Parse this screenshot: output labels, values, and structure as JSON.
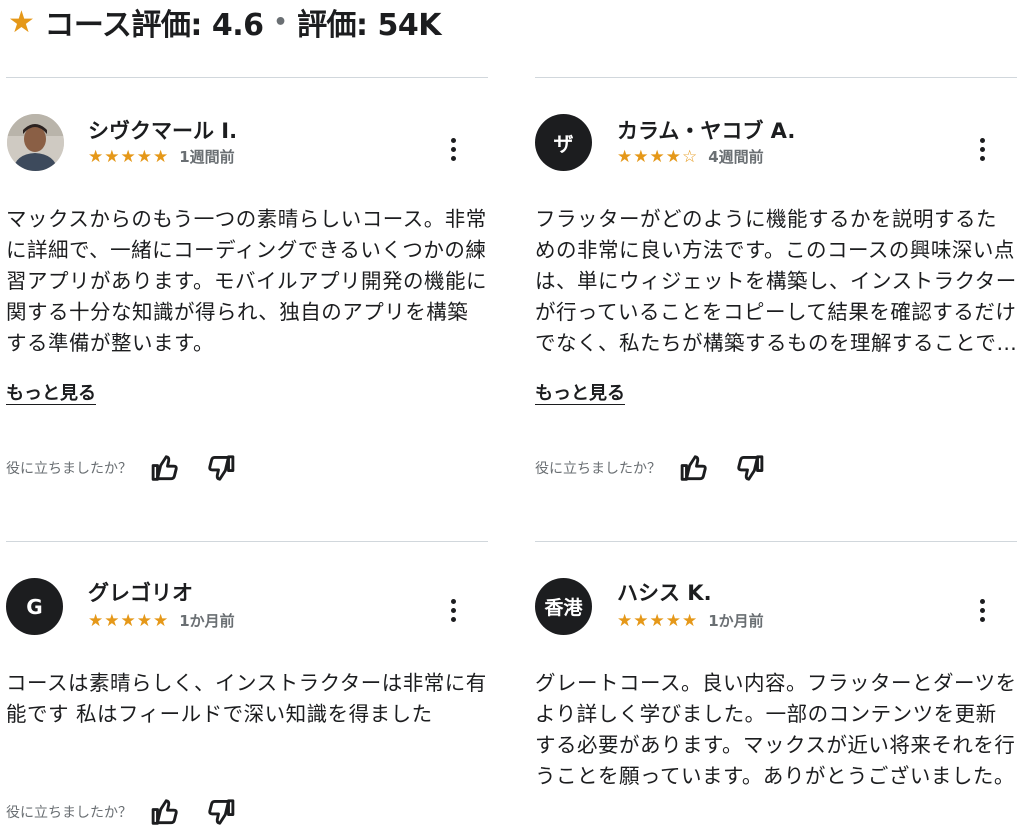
{
  "header": {
    "star_icon": "star-icon",
    "course_rating_label": "コース評価: 4.6",
    "separator": "•",
    "ratings_count_label": "評価: 54K",
    "accent_color": "#e59819"
  },
  "reviews": [
    {
      "avatar_text": "",
      "avatar_kind": "photo",
      "name": "シヴクマール I.",
      "stars": "★★★★★",
      "rating": 5,
      "date": "1週間前",
      "body": "マックスからのもう一つの素晴らしいコース。非常に詳細で、一緒にコーディングできるいくつかの練習アプリがあります。モバイルアプリ開発の機能に関する十分な知識が得られ、独自のアプリを構築する準備が整います。",
      "more_label": "もっと見る",
      "helpful_label": "役に立ちましたか？"
    },
    {
      "avatar_text": "ザ",
      "avatar_kind": "initial",
      "name": "カラム・ヤコブ A.",
      "stars": "★★★★☆",
      "rating": 4,
      "date": "4週間前",
      "body": "フラッターがどのように機能するかを説明するための非常に良い方法です。このコースの興味深い点は、単にウィジェットを構築し、インストラクターが行っていることをコピーして結果を確認するだけでなく、私たちが構築するものを理解することです。",
      "more_label": "もっと見る",
      "helpful_label": "役に立ちましたか？"
    },
    {
      "avatar_text": "G",
      "avatar_kind": "initial",
      "name": "グレゴリオ",
      "stars": "★★★★★",
      "rating": 5,
      "date": "1か月前",
      "body": "コースは素晴らしく、インストラクターは非常に有能です 私はフィールドで深い知識を得ました",
      "helpful_label": "役に立ちましたか？"
    },
    {
      "avatar_text": "香港",
      "avatar_kind": "initial",
      "name": "ハシス K.",
      "stars": "★★★★★",
      "rating": 5,
      "date": "1か月前",
      "body": "グレートコース。良い内容。フラッターとダーツをより詳しく学びました。一部のコンテンツを更新する必要があります。マックスが近い将来それを行うことを願っています。ありがとうございました。",
      "helpful_label": "役に立ちましたか？"
    }
  ]
}
